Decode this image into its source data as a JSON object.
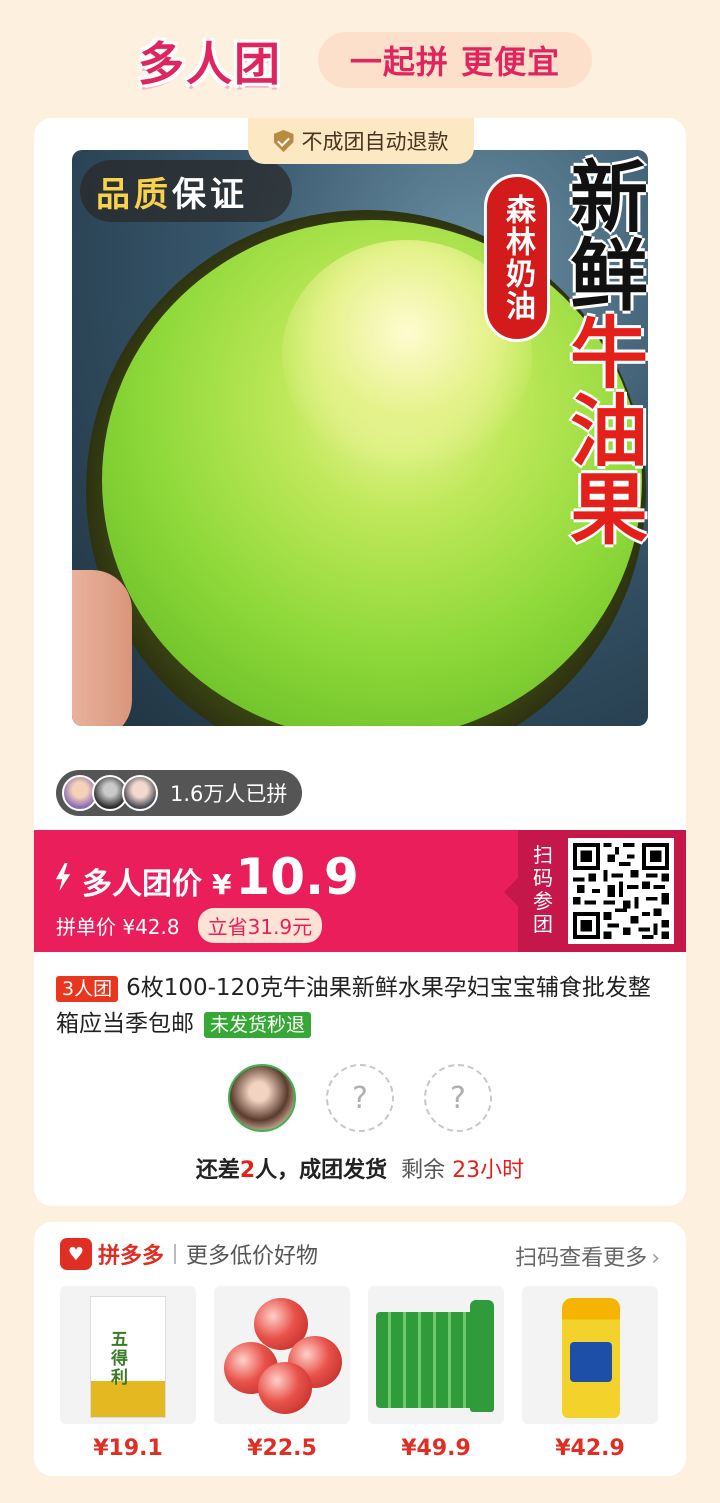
{
  "header": {
    "title": "多人团",
    "slogan": "一起拼 更便宜"
  },
  "card": {
    "refund_tag": "不成团自动退款",
    "image": {
      "quality_badge_part1": "品质",
      "quality_badge_part2": "保证",
      "side_tag": "森林奶油",
      "title_black": "新鲜",
      "title_red": "牛油果"
    },
    "joined_count": "1.6万人已拼",
    "price": {
      "label": "多人团价",
      "currency": "¥",
      "value": "10.9",
      "single_price": "拼单价 ¥42.8",
      "save_badge": "立省31.9元"
    },
    "scan_label": "扫码参团",
    "product": {
      "group_tag": "3人团",
      "title": "6枚100-120克牛油果新鲜水果孕妇宝宝辅食批发整箱应当季包邮",
      "ship_tag": "未发货秒退"
    },
    "members": {
      "placeholder": "?"
    },
    "status": {
      "part1": "还差",
      "count": "2",
      "part2": "人，成团发货",
      "remaining_label": "剩余",
      "remaining_time": "23小时"
    }
  },
  "recommend": {
    "brand": "拼多多",
    "subtitle": "更多低价好物",
    "more": "扫码查看更多",
    "items": [
      {
        "name": "flour-product",
        "price": "¥19.1"
      },
      {
        "name": "apple-product",
        "price": "¥22.5"
      },
      {
        "name": "sprite-product",
        "price": "¥49.9"
      },
      {
        "name": "oil-product",
        "price": "¥42.9"
      }
    ]
  },
  "colors": {
    "accent": "#e91e5a",
    "brand_red": "#e02e24",
    "success": "#35a835",
    "background": "#fdf0df"
  },
  "icons": [
    "shield-check-icon",
    "lightning-icon",
    "qr-code-icon",
    "chevron-right-icon",
    "pinduoduo-logo-icon"
  ]
}
